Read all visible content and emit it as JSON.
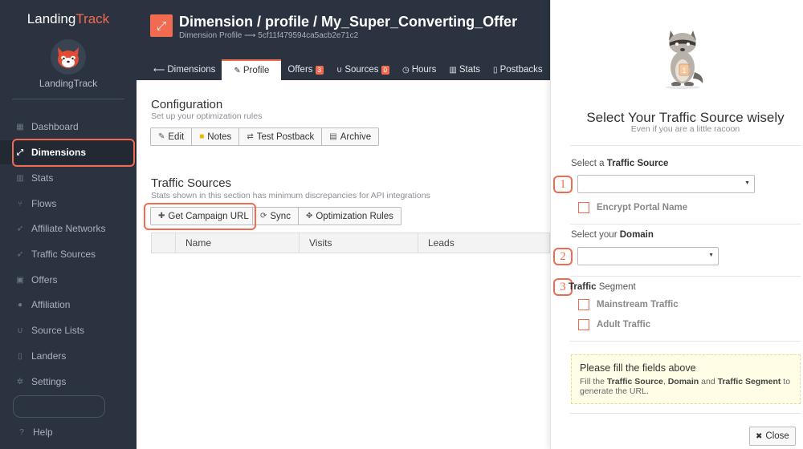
{
  "sidebar": {
    "brand_main": "Landing",
    "brand_accent": "Track",
    "logo_name": "LandingTrack",
    "items": [
      {
        "label": "Dashboard",
        "icon": "dashboard-icon"
      },
      {
        "label": "Dimensions",
        "icon": "expand-icon",
        "active": true
      },
      {
        "label": "Stats",
        "icon": "bar-chart-icon"
      },
      {
        "label": "Flows",
        "icon": "flow-icon"
      },
      {
        "label": "Affiliate Networks",
        "icon": "rocket-icon"
      },
      {
        "label": "Traffic Sources",
        "icon": "rocket-icon"
      },
      {
        "label": "Offers",
        "icon": "image-icon"
      },
      {
        "label": "Affiliation",
        "icon": "users-icon"
      },
      {
        "label": "Source Lists",
        "icon": "magnet-icon"
      },
      {
        "label": "Landers",
        "icon": "file-icon"
      },
      {
        "label": "Settings",
        "icon": "gear-icon"
      },
      {
        "label": "Help",
        "icon": "question-icon"
      }
    ]
  },
  "header": {
    "title": "Dimension / profile / My_Super_Converting_Offer",
    "subtitle": "Dimension Profile ⟶ 5cf11f479594ca5acb2e71c2",
    "tabs": [
      {
        "label": "Dimensions",
        "icon": "arrow-left-icon"
      },
      {
        "label": "Profile",
        "icon": "pencil-icon",
        "active": true
      },
      {
        "label": "Offers",
        "badge": "3"
      },
      {
        "label": "Sources",
        "icon": "magnet-icon",
        "badge": "0"
      },
      {
        "label": "Hours",
        "icon": "clock-icon"
      },
      {
        "label": "Stats",
        "icon": "bar-chart-icon"
      },
      {
        "label": "Postbacks",
        "icon": "file-icon"
      }
    ]
  },
  "configuration": {
    "title": "Configuration",
    "subtitle": "Set up your optimization rules",
    "buttons": [
      "Edit",
      "Notes",
      "Test Postback",
      "Archive"
    ]
  },
  "traffic_sources": {
    "title": "Traffic Sources",
    "subtitle": "Stats shown in this section has minimum discrepancies for API integrations",
    "buttons": [
      "Get Campaign URL",
      "Sync",
      "Optimization Rules"
    ],
    "columns": [
      "Name",
      "Visits",
      "Leads"
    ]
  },
  "panel": {
    "title": "Select Your Traffic Source wisely",
    "subtitle": "Even if you are a little racoon",
    "mascot_badge": "1",
    "ts_label_prefix": "Select a ",
    "ts_label_bold": "Traffic Source",
    "ts_step": "1",
    "encrypt_label": "Encrypt Portal Name",
    "domain_label_prefix": "Select your ",
    "domain_label_bold": "Domain",
    "domain_step": "2",
    "segment_label_bold": "Traffic",
    "segment_label_rest": " Segment",
    "segment_step": "3",
    "segments": [
      "Mainstream Traffic",
      "Adult Traffic"
    ],
    "info_title": "Please fill the fields above",
    "info_fill": "Fill the ",
    "info_ts": "Traffic Source",
    "info_sep1": ", ",
    "info_domain": "Domain",
    "info_and": " and ",
    "info_segment": "Traffic Segment",
    "info_tail": " to generate the URL.",
    "close_label": "Close"
  },
  "colors": {
    "accent": "#f26a4f",
    "sidebar_bg": "#2b3340"
  }
}
